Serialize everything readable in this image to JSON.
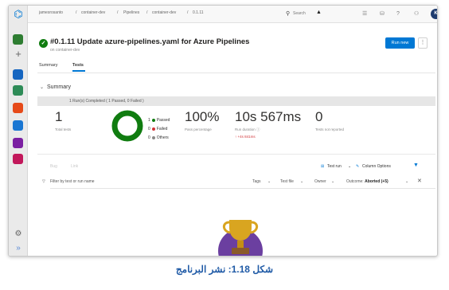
{
  "breadcrumb": [
    "jamesrosanto",
    "container-dev",
    "Pipelines",
    "container-dev",
    "0.1.11"
  ],
  "search": {
    "label": "Search"
  },
  "user": {
    "initial": "K"
  },
  "run": {
    "title": "#0.1.11 Update azure-pipelines.yaml for Azure Pipelines",
    "subtitle": "on container-dev",
    "status": "succeeded"
  },
  "actions": {
    "run_new": "Run new",
    "more": "⋮"
  },
  "tabs": [
    {
      "label": "Summary"
    },
    {
      "label": "Tests",
      "active": true
    }
  ],
  "summary": {
    "title": "Summary",
    "banner": "1 Run(s) Completed ( 1 Passed, 0 Failed )",
    "total_tests": {
      "value": "1",
      "label": "Total tests"
    },
    "legend": [
      {
        "count": "1",
        "label": "Passed",
        "color": "#107c10"
      },
      {
        "count": "0",
        "label": "Failed",
        "color": "#d13438"
      },
      {
        "count": "0",
        "label": "Others",
        "color": "#8a8886"
      }
    ],
    "pass_percentage": {
      "value": "100%",
      "label": "Pass percentage"
    },
    "run_duration": {
      "value": "10s 567ms",
      "label": "Run duration ⓘ",
      "delta": "↑ +4s 841ms"
    },
    "not_reported": {
      "value": "0",
      "label": "Tests not reported"
    }
  },
  "toolbar": {
    "bug": "Bug",
    "link": "Link",
    "test_run": "Test run",
    "column_options": "Column Options"
  },
  "filters": {
    "search_placeholder": "Filter by test or run name",
    "tags": "Tags",
    "test_file": "Test file",
    "owner": "Owner",
    "outcome_label": "Outcome:",
    "outcome_value": "Aborted (+5)"
  },
  "caption": "شكل 1.18: نشر البرنامج",
  "colors": {
    "accent": "#0078d4",
    "success": "#107c10",
    "failed": "#d13438",
    "caption": "#1f5aa6"
  },
  "nav_icons": [
    "azure-devops-icon",
    "plus-icon",
    "boards-icon",
    "repos-icon",
    "pipelines-icon",
    "test-plans-icon",
    "artifacts-icon",
    "settings-icon",
    "expand-icon"
  ]
}
